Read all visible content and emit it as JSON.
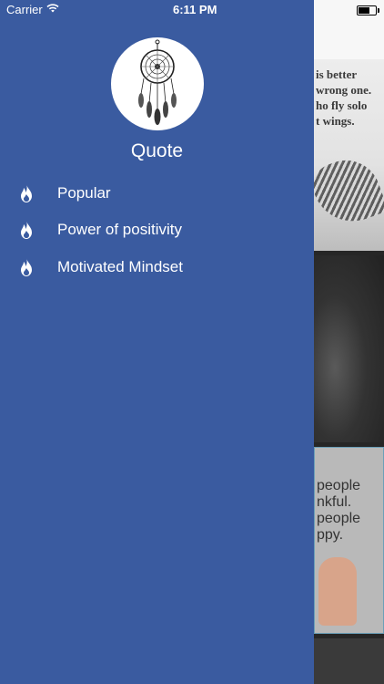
{
  "status_bar": {
    "carrier": "Carrier",
    "time": "6:11 PM",
    "wifi_icon": "wifi-icon",
    "battery_icon": "battery-icon"
  },
  "drawer": {
    "background_color": "#3a5ba0",
    "avatar_icon": "dreamcatcher-icon",
    "title": "Quote",
    "items": [
      {
        "label": "Popular",
        "icon": "flame-icon"
      },
      {
        "label": "Power of positivity",
        "icon": "flame-icon"
      },
      {
        "label": "Motivated Mindset",
        "icon": "flame-icon"
      }
    ]
  },
  "background_cards": {
    "card1_text": [
      "is better",
      "wrong one.",
      "ho fly solo",
      "t wings."
    ],
    "card3_text": [
      "people",
      "nkful.",
      "people",
      "ppy."
    ]
  }
}
